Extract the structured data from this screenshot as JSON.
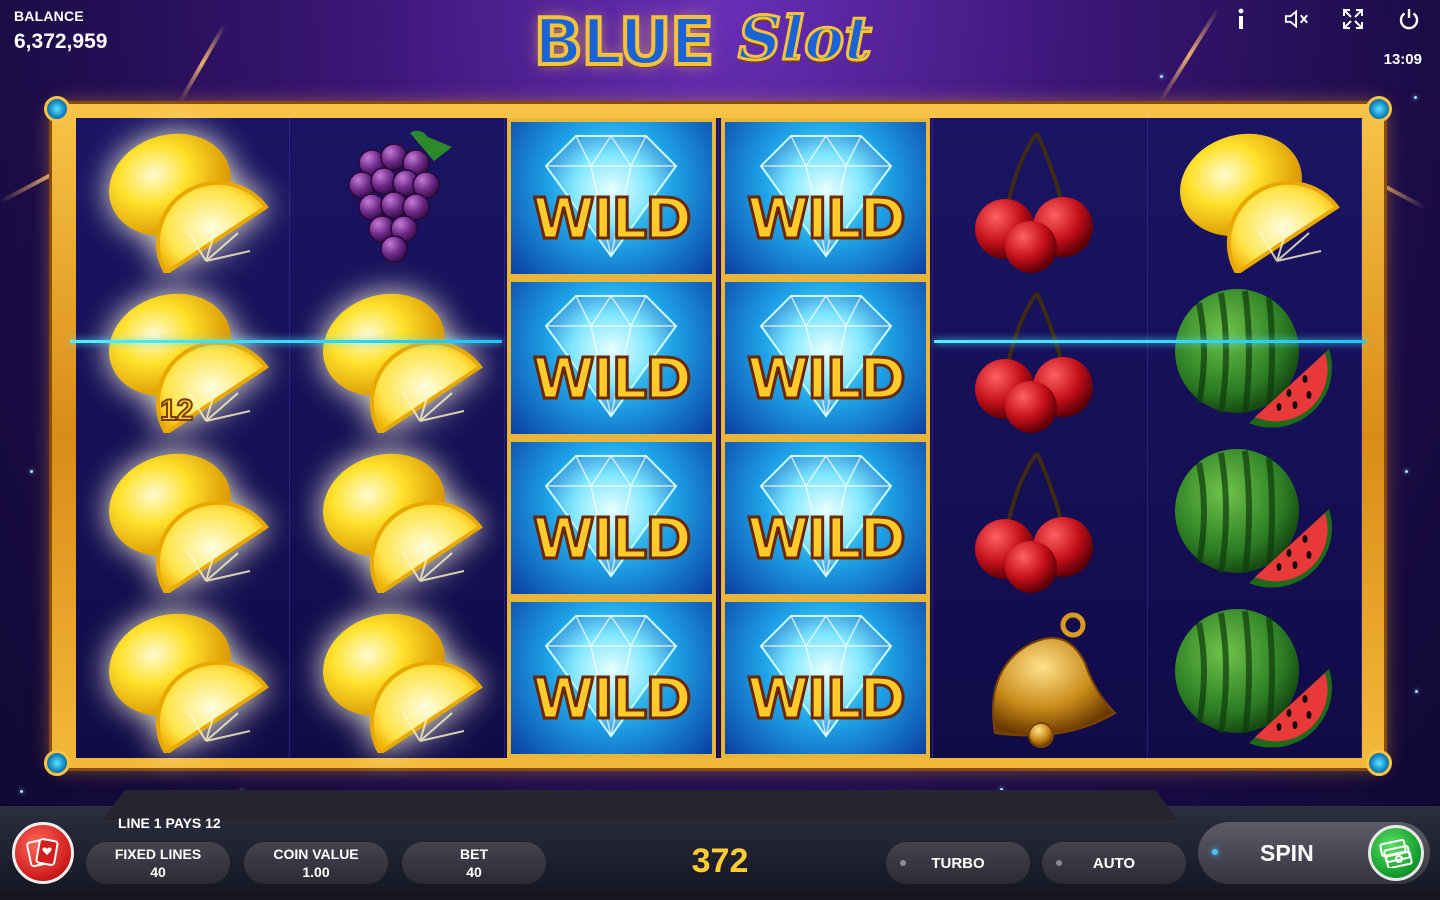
{
  "balance": {
    "label": "BALANCE",
    "value": "6,372,959"
  },
  "logo": {
    "word1": "BLUE",
    "word2": "Slot"
  },
  "top_icons": [
    "info-icon",
    "sound-muted-icon",
    "fullscreen-icon",
    "power-icon"
  ],
  "clock": "13:09",
  "reels": [
    [
      "lemon",
      "lemon",
      "lemon",
      "lemon"
    ],
    [
      "grapes",
      "lemon",
      "lemon",
      "lemon"
    ],
    [
      "wild",
      "wild",
      "wild",
      "wild"
    ],
    [
      "wild",
      "wild",
      "wild",
      "wild"
    ],
    [
      "cherries",
      "cherries",
      "cherries",
      "bell"
    ],
    [
      "lemon",
      "watermelon",
      "watermelon",
      "watermelon"
    ]
  ],
  "wild_label": "WILD",
  "win_amount_badge": "12",
  "status_message": "LINE 1 PAYS 12",
  "controls": {
    "fixed_lines": {
      "label": "FIXED LINES",
      "value": "40"
    },
    "coin_value": {
      "label": "COIN VALUE",
      "value": "1.00"
    },
    "bet": {
      "label": "BET",
      "value": "40"
    },
    "win_total": "372",
    "turbo": "TURBO",
    "auto": "AUTO",
    "spin": "SPIN"
  },
  "colors": {
    "accent_gold": "#f6c23a",
    "payline_cyan": "#4ff0ff",
    "win_yellow": "#ffcc33",
    "spin_green": "#19a433"
  }
}
